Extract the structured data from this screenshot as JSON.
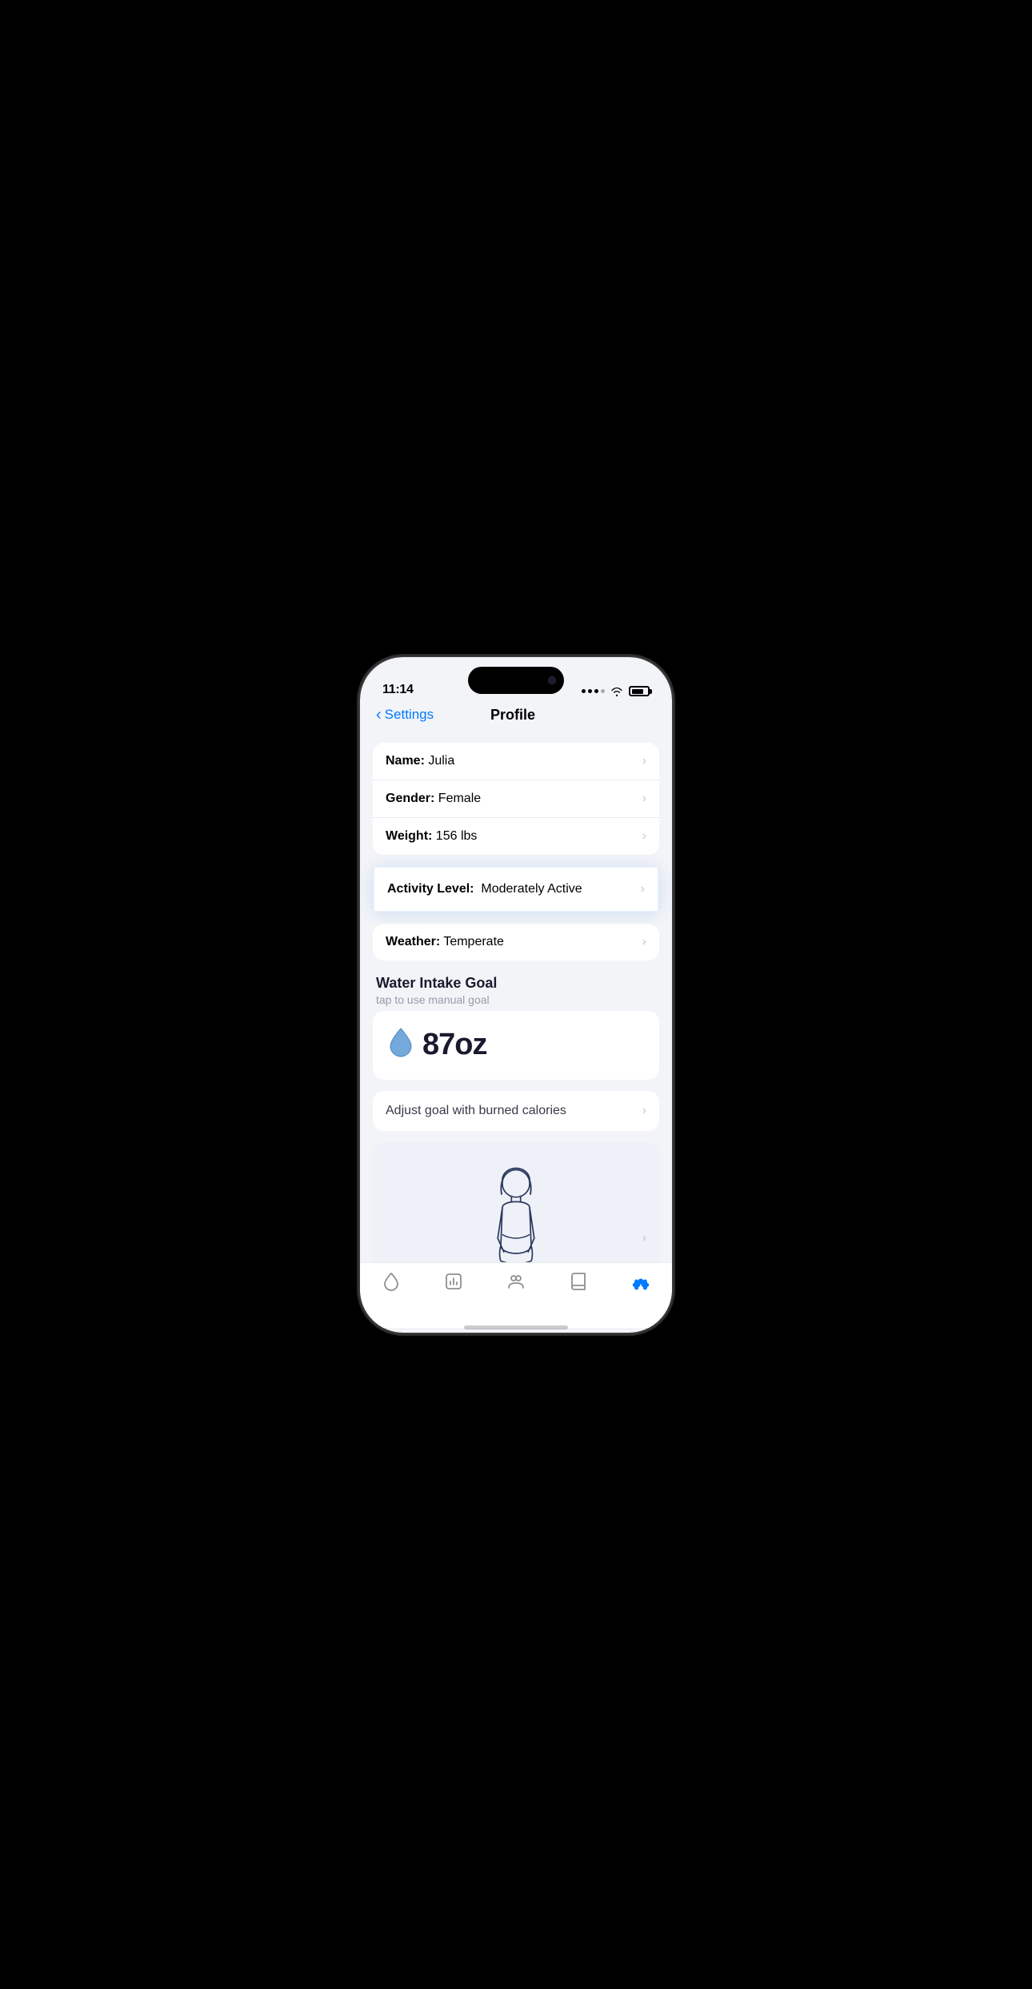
{
  "status": {
    "time": "11:14",
    "icons": [
      "signal",
      "wifi",
      "battery"
    ]
  },
  "nav": {
    "back_label": "Settings",
    "title": "Profile"
  },
  "profile_rows": [
    {
      "label": "Name:",
      "value": "Julia"
    },
    {
      "label": "Gender:",
      "value": "Female"
    },
    {
      "label": "Weight:",
      "value": "156 lbs"
    }
  ],
  "activity_row": {
    "label": "Activity Level:",
    "value": "Moderately Active"
  },
  "weather_row": {
    "label": "Weather:",
    "value": "Temperate"
  },
  "water_section": {
    "title": "Water Intake Goal",
    "subtitle": "tap to use manual goal",
    "amount": "87oz"
  },
  "adjust_goal": {
    "label": "Adjust goal with burned calories"
  },
  "tabs": [
    {
      "name": "water",
      "label": ""
    },
    {
      "name": "stats",
      "label": ""
    },
    {
      "name": "profile",
      "label": ""
    },
    {
      "name": "journal",
      "label": ""
    },
    {
      "name": "settings",
      "label": ""
    }
  ],
  "colors": {
    "accent": "#007aff",
    "text_primary": "#1a1a2e",
    "text_secondary": "#9a9aaa"
  }
}
